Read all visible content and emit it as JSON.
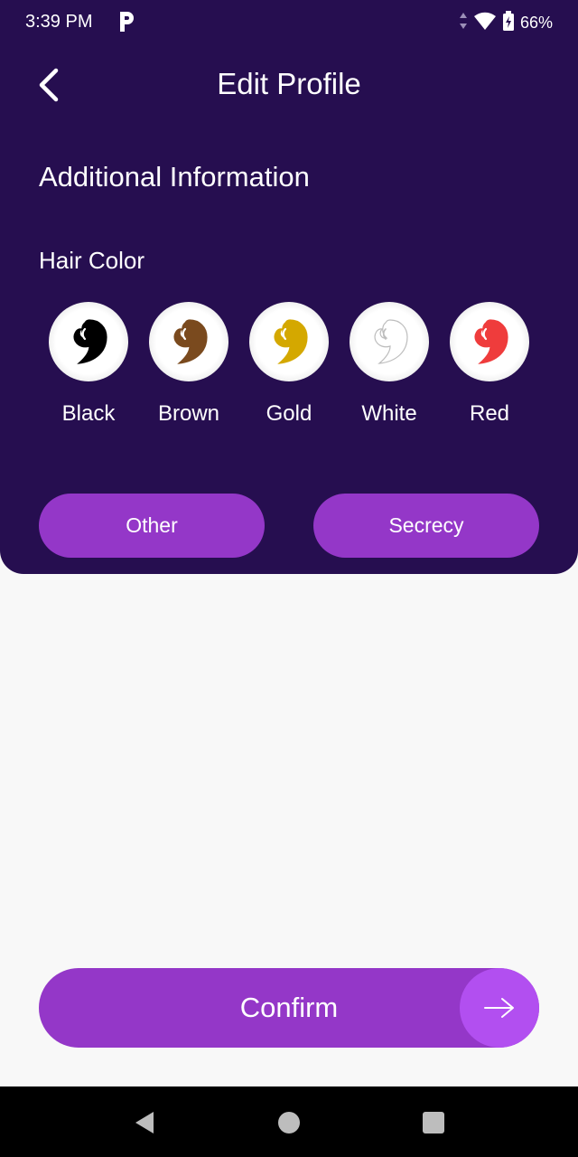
{
  "status_bar": {
    "time": "3:39 PM",
    "battery": "66%",
    "icons": [
      "parking-app-icon",
      "data-arrows-icon",
      "wifi-icon",
      "battery-charging-icon"
    ]
  },
  "header": {
    "title": "Edit Profile",
    "back_icon": "chevron-left-icon"
  },
  "section": {
    "title": "Additional Information",
    "hair_color_label": "Hair Color"
  },
  "hair_colors": [
    {
      "label": "Black",
      "color": "#000000"
    },
    {
      "label": "Brown",
      "color": "#7a4a1e"
    },
    {
      "label": "Gold",
      "color": "#d4a800"
    },
    {
      "label": "White",
      "color": "#ffffff"
    },
    {
      "label": "Red",
      "color": "#ef3c3c"
    }
  ],
  "options": {
    "other_label": "Other",
    "secrecy_label": "Secrecy"
  },
  "confirm": {
    "label": "Confirm",
    "icon": "arrow-right-icon"
  },
  "colors": {
    "panel_bg": "#260e50",
    "accent": "#9437c8",
    "accent_light": "#b24ff0"
  }
}
